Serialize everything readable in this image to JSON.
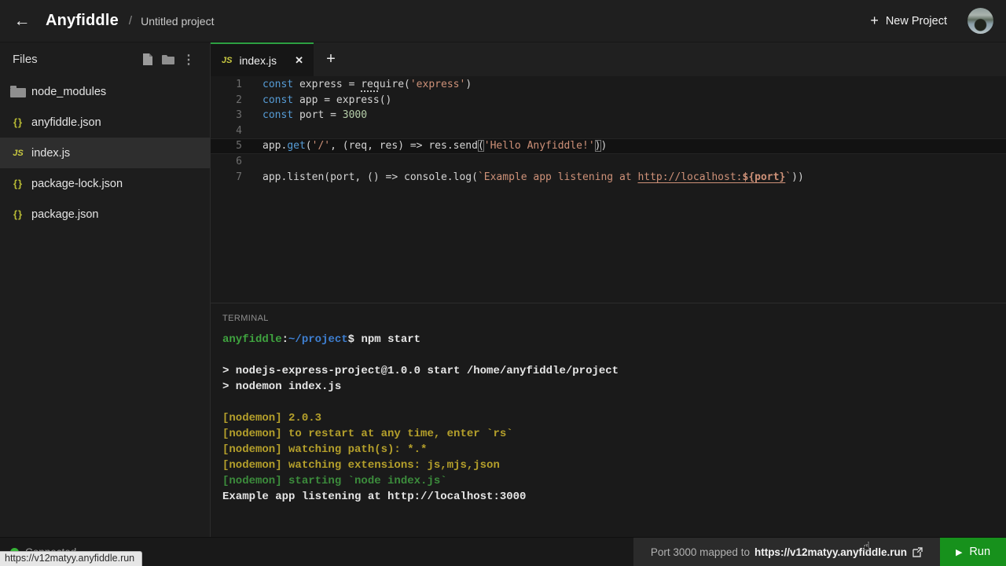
{
  "header": {
    "back_icon": "←",
    "brand": "Anyfiddle",
    "separator": "/",
    "project_title": "Untitled project",
    "new_project_plus": "+",
    "new_project_label": "New Project"
  },
  "sidebar": {
    "title": "Files",
    "icon_glyphs": {
      "json": "{}",
      "js": "JS",
      "kebab": "⋮"
    },
    "files": [
      {
        "label": "node_modules",
        "icon": "folder",
        "selected": false
      },
      {
        "label": "anyfiddle.json",
        "icon": "json",
        "selected": false
      },
      {
        "label": "index.js",
        "icon": "js",
        "selected": true
      },
      {
        "label": "package-lock.json",
        "icon": "json",
        "selected": false
      },
      {
        "label": "package.json",
        "icon": "json",
        "selected": false
      }
    ]
  },
  "editor": {
    "tab": {
      "icon": "JS",
      "label": "index.js",
      "close": "✕"
    },
    "new_tab": "+",
    "lines": [
      {
        "num": 1,
        "segments": [
          {
            "t": "const",
            "c": "kw"
          },
          {
            "t": " express = ",
            "c": "pl"
          },
          {
            "t": "req",
            "c": "pl hint"
          },
          {
            "t": "uire(",
            "c": "pl"
          },
          {
            "t": "'express'",
            "c": "str"
          },
          {
            "t": ")",
            "c": "pl"
          }
        ]
      },
      {
        "num": 2,
        "segments": [
          {
            "t": "const",
            "c": "kw"
          },
          {
            "t": " app = express()",
            "c": "pl"
          }
        ]
      },
      {
        "num": 3,
        "segments": [
          {
            "t": "const",
            "c": "kw"
          },
          {
            "t": " port = ",
            "c": "pl"
          },
          {
            "t": "3000",
            "c": "num"
          }
        ]
      },
      {
        "num": 4,
        "segments": []
      },
      {
        "num": 5,
        "current": true,
        "segments": [
          {
            "t": "app.",
            "c": "pl"
          },
          {
            "t": "get",
            "c": "fn"
          },
          {
            "t": "(",
            "c": "pl"
          },
          {
            "t": "'/'",
            "c": "str"
          },
          {
            "t": ", (req, res) => res.send",
            "c": "pl"
          },
          {
            "t": "(",
            "c": "pl bm"
          },
          {
            "t": "'Hello Anyfiddle!'",
            "c": "str"
          },
          {
            "t": ")",
            "c": "pl bm"
          },
          {
            "t": ")",
            "c": "pl"
          }
        ]
      },
      {
        "num": 6,
        "segments": []
      },
      {
        "num": 7,
        "segments": [
          {
            "t": "app.listen(port, () => console.log(",
            "c": "pl"
          },
          {
            "t": "`Example app listening at ",
            "c": "str"
          },
          {
            "t": "http://localhost:",
            "c": "str lnk"
          },
          {
            "t": "${port}",
            "c": "str lnk strb"
          },
          {
            "t": "`",
            "c": "str"
          },
          {
            "t": "))",
            "c": "pl"
          }
        ]
      }
    ]
  },
  "terminal": {
    "title": "TERMINAL",
    "lines": [
      [
        {
          "t": "anyfiddle",
          "c": "tg"
        },
        {
          "t": ":",
          "c": "tw"
        },
        {
          "t": "~/project",
          "c": "tb"
        },
        {
          "t": "$",
          "c": "tw"
        },
        {
          "t": " npm start",
          "c": "tw"
        }
      ],
      [],
      [
        {
          "t": "> nodejs-express-project@1.0.0 start /home/anyfiddle/project",
          "c": "tw"
        }
      ],
      [
        {
          "t": "> nodemon index.js",
          "c": "tw"
        }
      ],
      [],
      [
        {
          "t": "[nodemon] 2.0.3",
          "c": "ty"
        }
      ],
      [
        {
          "t": "[nodemon] to restart at any time, enter `rs`",
          "c": "ty"
        }
      ],
      [
        {
          "t": "[nodemon] watching path(s): *.*",
          "c": "ty"
        }
      ],
      [
        {
          "t": "[nodemon] watching extensions: js,mjs,json",
          "c": "ty"
        }
      ],
      [
        {
          "t": "[nodemon] starting `node index.js`",
          "c": "tg2"
        }
      ],
      [
        {
          "t": "Example app listening at http://localhost:3000",
          "c": "tw"
        }
      ]
    ]
  },
  "statusbar": {
    "connected_label": "Connected",
    "port_text": "Port 3000 mapped to",
    "port_link": "https://v12matyy.anyfiddle.run",
    "run_play": "▶",
    "run_label": "Run"
  },
  "browser_tooltip": "https://v12matyy.anyfiddle.run",
  "mouse_cursor_glyph": "☝",
  "colors": {
    "accent_tab_green": "#2da042",
    "run_button_green": "#17911c",
    "connected_dot_green": "#36b336",
    "keyword_blue": "#569cd6",
    "string_orange": "#ce9178",
    "number_green": "#b5cea8",
    "terminal_yellow": "#b5a02b",
    "terminal_green": "#3fa33f",
    "terminal_blue": "#3e7fd1"
  }
}
